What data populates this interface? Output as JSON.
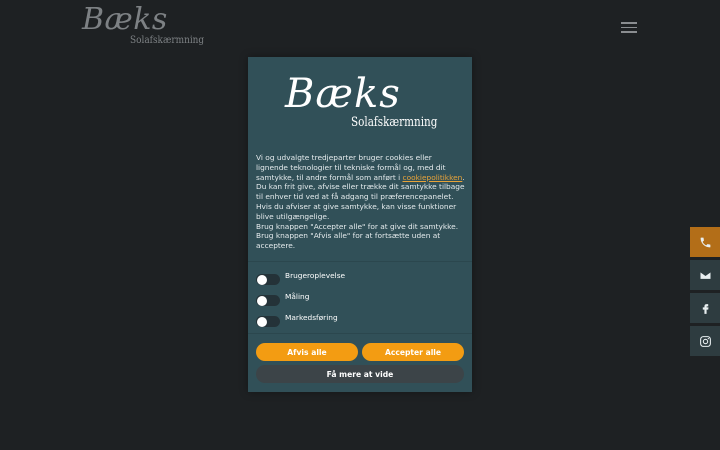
{
  "site": {
    "logo_script": "Bæks",
    "logo_sub": "Solafskærmning"
  },
  "sidebar": {
    "buttons": [
      {
        "icon": "phone-icon"
      },
      {
        "icon": "mail-icon"
      },
      {
        "icon": "facebook-icon"
      },
      {
        "icon": "instagram-icon"
      }
    ]
  },
  "consent": {
    "logo_script": "Bæks",
    "logo_sub": "Solafskærmning",
    "text_1a": "Vi og udvalgte tredjeparter bruger cookies eller lignende teknologier til tekniske formål og, med dit samtykke, til andre formål som anført i ",
    "policy_link": "cookiepolitikken",
    "text_1b": ".",
    "text_2": "Du kan frit give, afvise eller trække dit samtykke tilbage til enhver tid ved at få adgang til præferencepanelet. Hvis du afviser at give samtykke, kan visse funktioner blive utilgængelige.",
    "text_3": "Brug knappen \"Accepter alle\" for at give dit samtykke. Brug knappen \"Afvis alle\" for at fortsætte uden at acceptere.",
    "toggles": [
      {
        "label": "Brugeroplevelse"
      },
      {
        "label": "Måling"
      },
      {
        "label": "Markedsføring"
      }
    ],
    "reject_label": "Afvis alle",
    "accept_label": "Accepter alle",
    "more_label": "Få mere at vide"
  },
  "colors": {
    "background": "#1e2123",
    "modal": "#315058",
    "accent": "#f39c12",
    "secondary_button": "#3c4448"
  }
}
